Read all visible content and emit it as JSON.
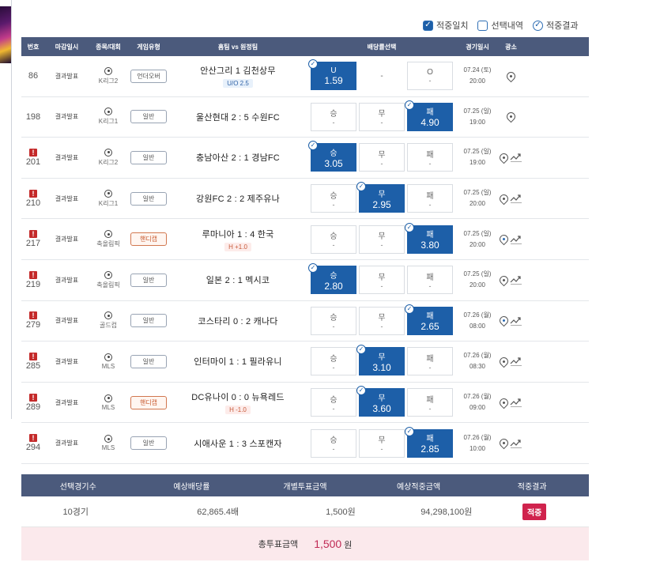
{
  "filters": [
    {
      "label": "적중일치",
      "checked": true
    },
    {
      "label": "선택내역",
      "checked": false
    },
    {
      "label": "적중결과",
      "checked": true
    }
  ],
  "columns": [
    "번호",
    "마감일시",
    "종목/대회",
    "게임유형",
    "홈팀 vs 원정팀",
    "배당률선택",
    "경기일시",
    "광소"
  ],
  "rows": [
    {
      "no": "86",
      "alert": false,
      "deadline": "결과발표",
      "league": "K리그2",
      "gtype": "언더오버",
      "gtype_hl": false,
      "home": "안산그리",
      "score": "1",
      "away": "김천상무",
      "sub": "U/O 2.5",
      "sub_type": "uo",
      "odds": [
        {
          "label": "U",
          "value": "1.59",
          "selected": true
        },
        {
          "label": "-",
          "value": "",
          "selected": false,
          "plain": true
        },
        {
          "label": "O",
          "value": "-",
          "selected": false
        }
      ],
      "date": "07.24 (토)",
      "time": "20:00",
      "trend": false,
      "pin_active": false
    },
    {
      "no": "198",
      "alert": false,
      "deadline": "결과발표",
      "league": "K리그1",
      "gtype": "일반",
      "gtype_hl": false,
      "home": "울산현대",
      "score": "2 : 5",
      "away": "수원FC",
      "sub": "",
      "sub_type": "",
      "odds": [
        {
          "label": "승",
          "value": "-",
          "selected": false
        },
        {
          "label": "무",
          "value": "-",
          "selected": false
        },
        {
          "label": "패",
          "value": "4.90",
          "selected": true
        }
      ],
      "date": "07.25 (일)",
      "time": "19:00",
      "trend": false,
      "pin_active": false
    },
    {
      "no": "201",
      "alert": true,
      "deadline": "결과발표",
      "league": "K리그2",
      "gtype": "일반",
      "gtype_hl": false,
      "home": "충남아산",
      "score": "2 : 1",
      "away": "경남FC",
      "sub": "",
      "sub_type": "",
      "odds": [
        {
          "label": "승",
          "value": "3.05",
          "selected": true
        },
        {
          "label": "무",
          "value": "-",
          "selected": false
        },
        {
          "label": "패",
          "value": "-",
          "selected": false
        }
      ],
      "date": "07.25 (일)",
      "time": "19:00",
      "trend": true,
      "pin_active": false
    },
    {
      "no": "210",
      "alert": true,
      "deadline": "결과발표",
      "league": "K리그1",
      "gtype": "일반",
      "gtype_hl": false,
      "home": "강원FC",
      "score": "2 : 2",
      "away": "제주유나",
      "sub": "",
      "sub_type": "",
      "odds": [
        {
          "label": "승",
          "value": "-",
          "selected": false
        },
        {
          "label": "무",
          "value": "2.95",
          "selected": true
        },
        {
          "label": "패",
          "value": "-",
          "selected": false
        }
      ],
      "date": "07.25 (일)",
      "time": "20:00",
      "trend": true,
      "pin_active": false
    },
    {
      "no": "217",
      "alert": true,
      "deadline": "결과발표",
      "league": "축올림픽",
      "gtype": "핸디캡",
      "gtype_hl": true,
      "home": "루마니아",
      "score": "1 : 4",
      "away": "한국",
      "sub": "H +1.0",
      "sub_type": "hc",
      "odds": [
        {
          "label": "승",
          "value": "-",
          "selected": false
        },
        {
          "label": "무",
          "value": "-",
          "selected": false
        },
        {
          "label": "패",
          "value": "3.80",
          "selected": true
        }
      ],
      "date": "07.25 (일)",
      "time": "20:00",
      "trend": true,
      "pin_active": true
    },
    {
      "no": "219",
      "alert": true,
      "deadline": "결과발표",
      "league": "축올림픽",
      "gtype": "일반",
      "gtype_hl": false,
      "home": "일본",
      "score": "2 : 1",
      "away": "멕시코",
      "sub": "",
      "sub_type": "",
      "odds": [
        {
          "label": "승",
          "value": "2.80",
          "selected": true
        },
        {
          "label": "무",
          "value": "-",
          "selected": false
        },
        {
          "label": "패",
          "value": "-",
          "selected": false
        }
      ],
      "date": "07.25 (일)",
      "time": "20:00",
      "trend": true,
      "pin_active": false
    },
    {
      "no": "279",
      "alert": true,
      "deadline": "결과발표",
      "league": "골드컵",
      "gtype": "일반",
      "gtype_hl": false,
      "home": "코스타리",
      "score": "0 : 2",
      "away": "캐나다",
      "sub": "",
      "sub_type": "",
      "odds": [
        {
          "label": "승",
          "value": "-",
          "selected": false
        },
        {
          "label": "무",
          "value": "-",
          "selected": false
        },
        {
          "label": "패",
          "value": "2.65",
          "selected": true
        }
      ],
      "date": "07.26 (월)",
      "time": "08:00",
      "trend": true,
      "pin_active": true
    },
    {
      "no": "285",
      "alert": true,
      "deadline": "결과발표",
      "league": "MLS",
      "gtype": "일반",
      "gtype_hl": false,
      "home": "인터마이",
      "score": "1 : 1",
      "away": "필라유니",
      "sub": "",
      "sub_type": "",
      "odds": [
        {
          "label": "승",
          "value": "-",
          "selected": false
        },
        {
          "label": "무",
          "value": "3.10",
          "selected": true
        },
        {
          "label": "패",
          "value": "-",
          "selected": false
        }
      ],
      "date": "07.26 (월)",
      "time": "08:30",
      "trend": true,
      "pin_active": false
    },
    {
      "no": "289",
      "alert": true,
      "deadline": "결과발표",
      "league": "MLS",
      "gtype": "핸디캡",
      "gtype_hl": true,
      "home": "DC유나이",
      "score": "0 : 0",
      "away": "뉴욕레드",
      "sub": "H -1.0",
      "sub_type": "hc",
      "odds": [
        {
          "label": "승",
          "value": "-",
          "selected": false
        },
        {
          "label": "무",
          "value": "3.60",
          "selected": true
        },
        {
          "label": "패",
          "value": "-",
          "selected": false
        }
      ],
      "date": "07.26 (월)",
      "time": "09:00",
      "trend": true,
      "pin_active": false
    },
    {
      "no": "294",
      "alert": true,
      "deadline": "결과발표",
      "league": "MLS",
      "gtype": "일반",
      "gtype_hl": false,
      "home": "시애사운",
      "score": "1 : 3",
      "away": "스포캔자",
      "sub": "",
      "sub_type": "",
      "odds": [
        {
          "label": "승",
          "value": "-",
          "selected": false
        },
        {
          "label": "무",
          "value": "-",
          "selected": false
        },
        {
          "label": "패",
          "value": "2.85",
          "selected": true
        }
      ],
      "date": "07.26 (월)",
      "time": "10:00",
      "trend": true,
      "pin_active": false
    }
  ],
  "summary": {
    "headers": [
      "선택경기수",
      "예상배당률",
      "개별투표금액",
      "예상적중금액",
      "적중결과"
    ],
    "values": {
      "games": "10경기",
      "odds": "62,865.4배",
      "bet": "1,500원",
      "win": "94,298,100원",
      "result": "적중"
    },
    "total_label": "총투표금액",
    "total_amount": "1,500",
    "total_unit": "원"
  },
  "colors": {
    "header": "#4b5a7c",
    "selected": "#1d5fa8",
    "alert": "#c42a2a",
    "result_badge": "#d0234d",
    "total_bg": "#fbe9ec"
  }
}
